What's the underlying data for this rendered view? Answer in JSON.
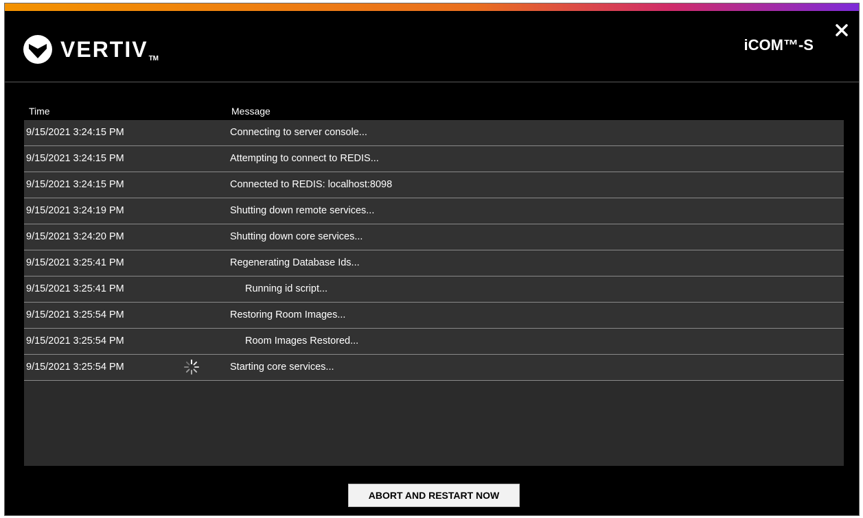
{
  "header": {
    "brand_name": "VERTIV",
    "brand_trademark": "TM",
    "product_name": "iCOM™-S",
    "close_icon": "close-icon",
    "logo_icon": "vertiv-logo-icon",
    "accent_gradient": [
      "#f39200",
      "#e96f1f",
      "#cf2c6a",
      "#7c2bd9"
    ]
  },
  "log_table": {
    "columns": {
      "time": "Time",
      "message": "Message"
    },
    "rows": [
      {
        "time": "9/15/2021 3:24:15 PM",
        "message": "Connecting to server console..."
      },
      {
        "time": "9/15/2021 3:24:15 PM",
        "message": "Attempting to connect to REDIS..."
      },
      {
        "time": "9/15/2021 3:24:15 PM",
        "message": "Connected to REDIS: localhost:8098"
      },
      {
        "time": "9/15/2021 3:24:19 PM",
        "message": "Shutting down remote services..."
      },
      {
        "time": "9/15/2021 3:24:20 PM",
        "message": "Shutting down core services..."
      },
      {
        "time": "9/15/2021 3:25:41 PM",
        "message": "Regenerating Database Ids..."
      },
      {
        "time": "9/15/2021 3:25:41 PM",
        "message": "Running id script..."
      },
      {
        "time": "9/15/2021 3:25:54 PM",
        "message": "Restoring Room Images..."
      },
      {
        "time": "9/15/2021 3:25:54 PM",
        "message": "Room Images Restored..."
      },
      {
        "time": "9/15/2021 3:25:54 PM",
        "message": "Starting core services...",
        "status_icon": "loading-spinner-icon"
      }
    ]
  },
  "footer": {
    "abort_button_label": "ABORT AND RESTART NOW"
  }
}
